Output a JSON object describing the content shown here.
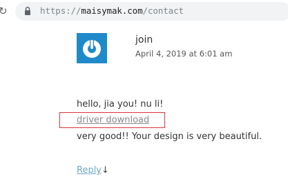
{
  "browser": {
    "url_scheme": "https://",
    "url_host": "maisymak.com",
    "url_path": "/contact"
  },
  "comment": {
    "author": "join",
    "date": "April 4, 2019 at 6:01 am",
    "line_1": "hello, jia you! nu li!",
    "link_text": "driver download",
    "line_3": "very good!! Your design is very beautiful.",
    "reply_label": "Reply",
    "reply_arrow": "↓"
  },
  "colors": {
    "avatar_bg": "#1f8ac9",
    "highlight_border": "#e0303a",
    "reply_link": "#6fa8c2"
  },
  "icons": {
    "reload": "reload-icon",
    "lock": "lock-icon",
    "avatar": "power-avatar-icon"
  }
}
